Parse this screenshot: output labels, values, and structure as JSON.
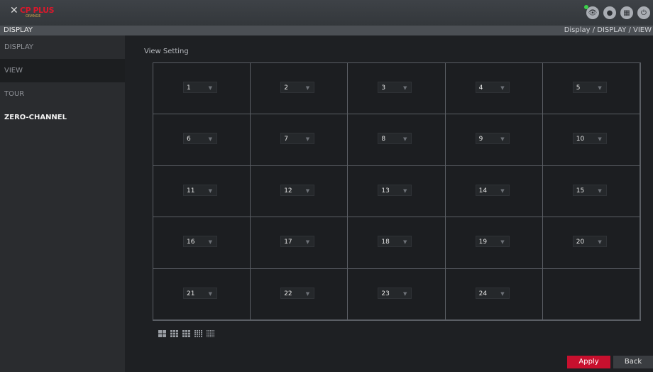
{
  "logo": {
    "brand": "CP PLUS",
    "sub": "ORANGE"
  },
  "header": {
    "title": "DISPLAY",
    "breadcrumb": "Display / DISPLAY / VIEW"
  },
  "sidebar": {
    "items": [
      {
        "label": "DISPLAY"
      },
      {
        "label": "VIEW"
      },
      {
        "label": "TOUR"
      },
      {
        "label": "ZERO-CHANNEL"
      }
    ]
  },
  "main": {
    "section_label": "View Setting",
    "channels": [
      "1",
      "2",
      "3",
      "4",
      "5",
      "6",
      "7",
      "8",
      "9",
      "10",
      "11",
      "12",
      "13",
      "14",
      "15",
      "16",
      "17",
      "18",
      "19",
      "20",
      "21",
      "22",
      "23",
      "24"
    ],
    "layout_icons": [
      "layout-4-icon",
      "layout-8-icon",
      "layout-9-icon",
      "layout-16-icon",
      "layout-25-icon"
    ]
  },
  "buttons": {
    "apply": "Apply",
    "back": "Back"
  },
  "icons": [
    "live-view-icon",
    "user-icon",
    "menu-icon",
    "power-icon"
  ],
  "colors": {
    "accent": "#c8102e",
    "status": "#3bd14a"
  }
}
